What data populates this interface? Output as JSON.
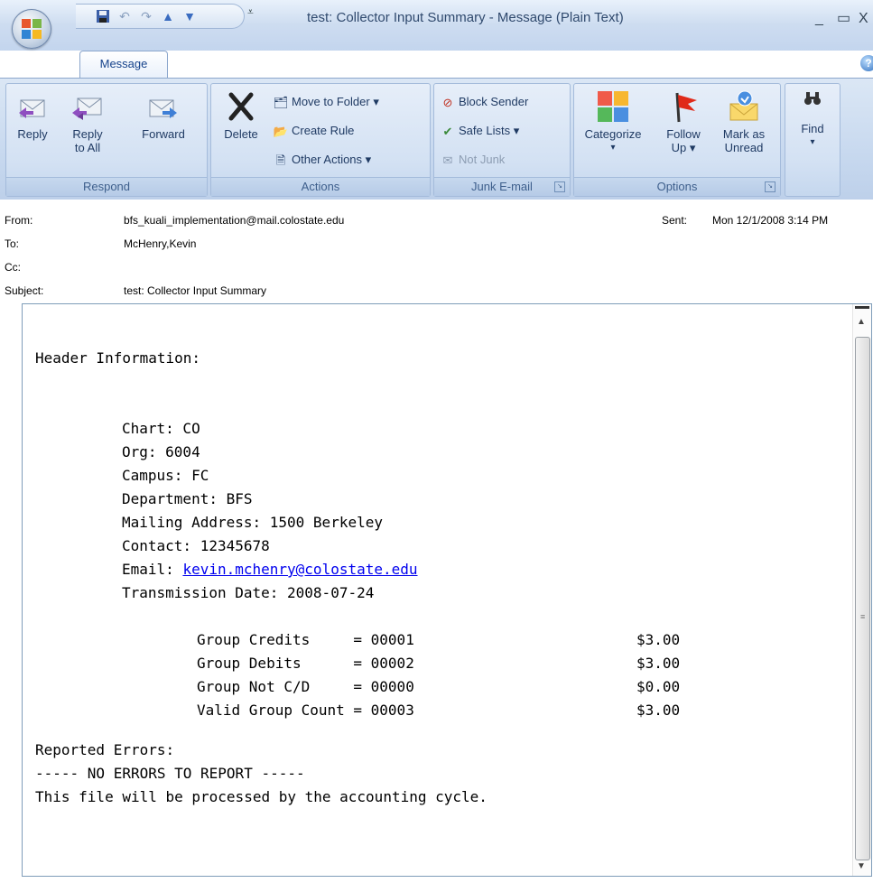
{
  "window": {
    "title": "test: Collector Input Summary - Message (Plain Text)",
    "minimize": "_",
    "maximize": "▭",
    "close": "X"
  },
  "ribbon": {
    "tab": "Message",
    "groups": {
      "respond": {
        "label": "Respond",
        "reply": "Reply",
        "reply_all_1": "Reply",
        "reply_all_2": "to All",
        "forward": "Forward"
      },
      "actions": {
        "label": "Actions",
        "delete": "Delete",
        "move_to_folder": "Move to Folder ▾",
        "create_rule": "Create Rule",
        "other_actions": "Other Actions ▾"
      },
      "junk": {
        "label": "Junk E-mail",
        "block_sender": "Block Sender",
        "safe_lists": "Safe Lists ▾",
        "not_junk": "Not Junk"
      },
      "options": {
        "label": "Options",
        "categorize": "Categorize",
        "follow_up_1": "Follow",
        "follow_up_2": "Up ▾",
        "mark_unread_1": "Mark as",
        "mark_unread_2": "Unread"
      },
      "find": {
        "label": "Find"
      }
    }
  },
  "header": {
    "from_label": "From:",
    "from_value": "bfs_kuali_implementation@mail.colostate.edu",
    "to_label": "To:",
    "to_value": "McHenry,Kevin",
    "cc_label": "Cc:",
    "cc_value": "",
    "subject_label": "Subject:",
    "subject_value": "test: Collector Input Summary",
    "sent_label": "Sent:",
    "sent_value": "Mon 12/1/2008 3:14 PM"
  },
  "body": {
    "header_info": "Header Information:",
    "chart": "Chart: CO",
    "org": "Org: 6004",
    "campus": "Campus: FC",
    "department": "Department: BFS",
    "mailing_address": "Mailing Address: 1500 Berkeley",
    "contact": "Contact: 12345678",
    "email_label": "Email: ",
    "email_link": "kevin.mchenry@colostate.edu",
    "transmission_date": "Transmission Date: 2008-07-24",
    "groups": [
      {
        "label": "Group Credits     = 00001",
        "amount": "$3.00"
      },
      {
        "label": "Group Debits      = 00002",
        "amount": "$3.00"
      },
      {
        "label": "Group Not C/D     = 00000",
        "amount": "$0.00"
      },
      {
        "label": "Valid Group Count = 00003",
        "amount": "$3.00"
      }
    ],
    "reported_errors": "Reported Errors:",
    "no_errors": "----- NO ERRORS TO REPORT -----",
    "processed": "This file will be processed by the accounting cycle."
  }
}
